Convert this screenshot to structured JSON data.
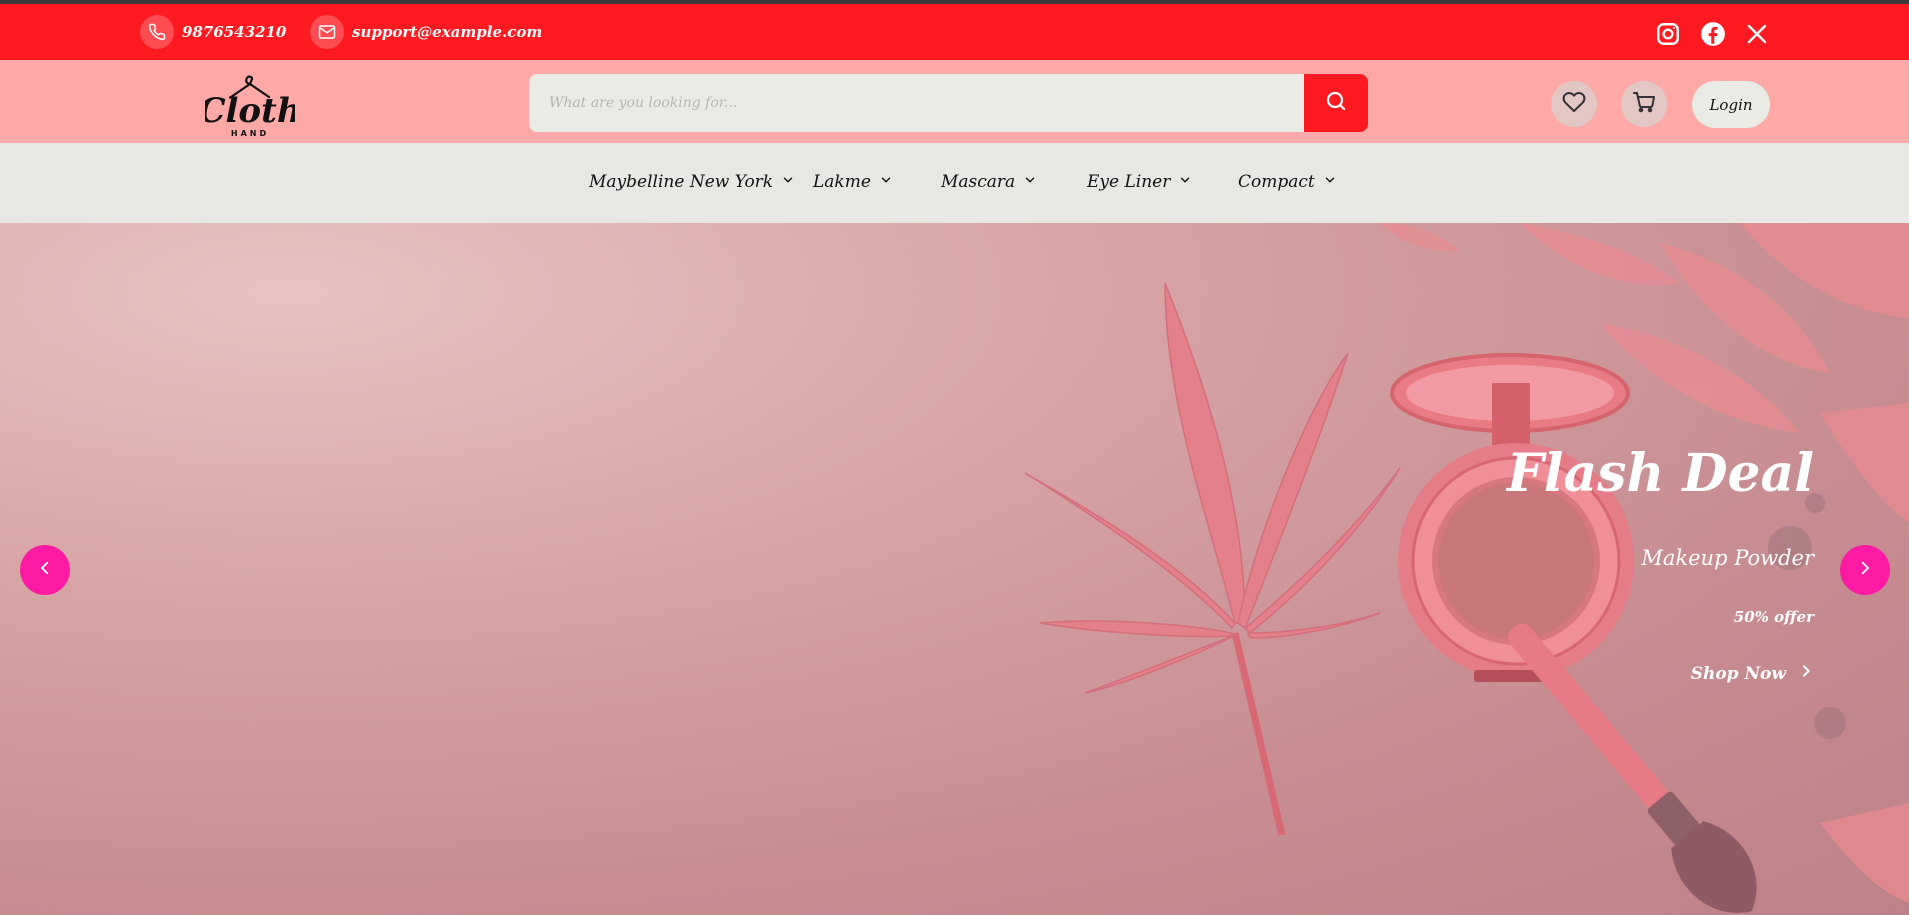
{
  "topbar": {
    "phone": "9876543210",
    "email": "support@example.com",
    "phone_icon": "phone-icon",
    "email_icon": "mail-icon",
    "social": [
      "instagram-icon",
      "facebook-icon",
      "x-icon"
    ]
  },
  "header": {
    "logo_text": "Cloth",
    "logo_sub": "HAND",
    "search_placeholder": "What are you looking for...",
    "login_label": "Login"
  },
  "nav": {
    "items": [
      {
        "label": "Maybelline New York"
      },
      {
        "label": "Lakme"
      },
      {
        "label": "Mascara"
      },
      {
        "label": "Eye Liner"
      },
      {
        "label": "Compact"
      }
    ]
  },
  "hero": {
    "title": "Flash Deal",
    "subtitle": "Makeup Powder",
    "offer": "50% offer",
    "cta": "Shop Now"
  },
  "colors": {
    "topbar": "#ff1a22",
    "header": "#ffa8a8",
    "nav": "#e8e7e4",
    "accent": "#ff1aa3"
  }
}
